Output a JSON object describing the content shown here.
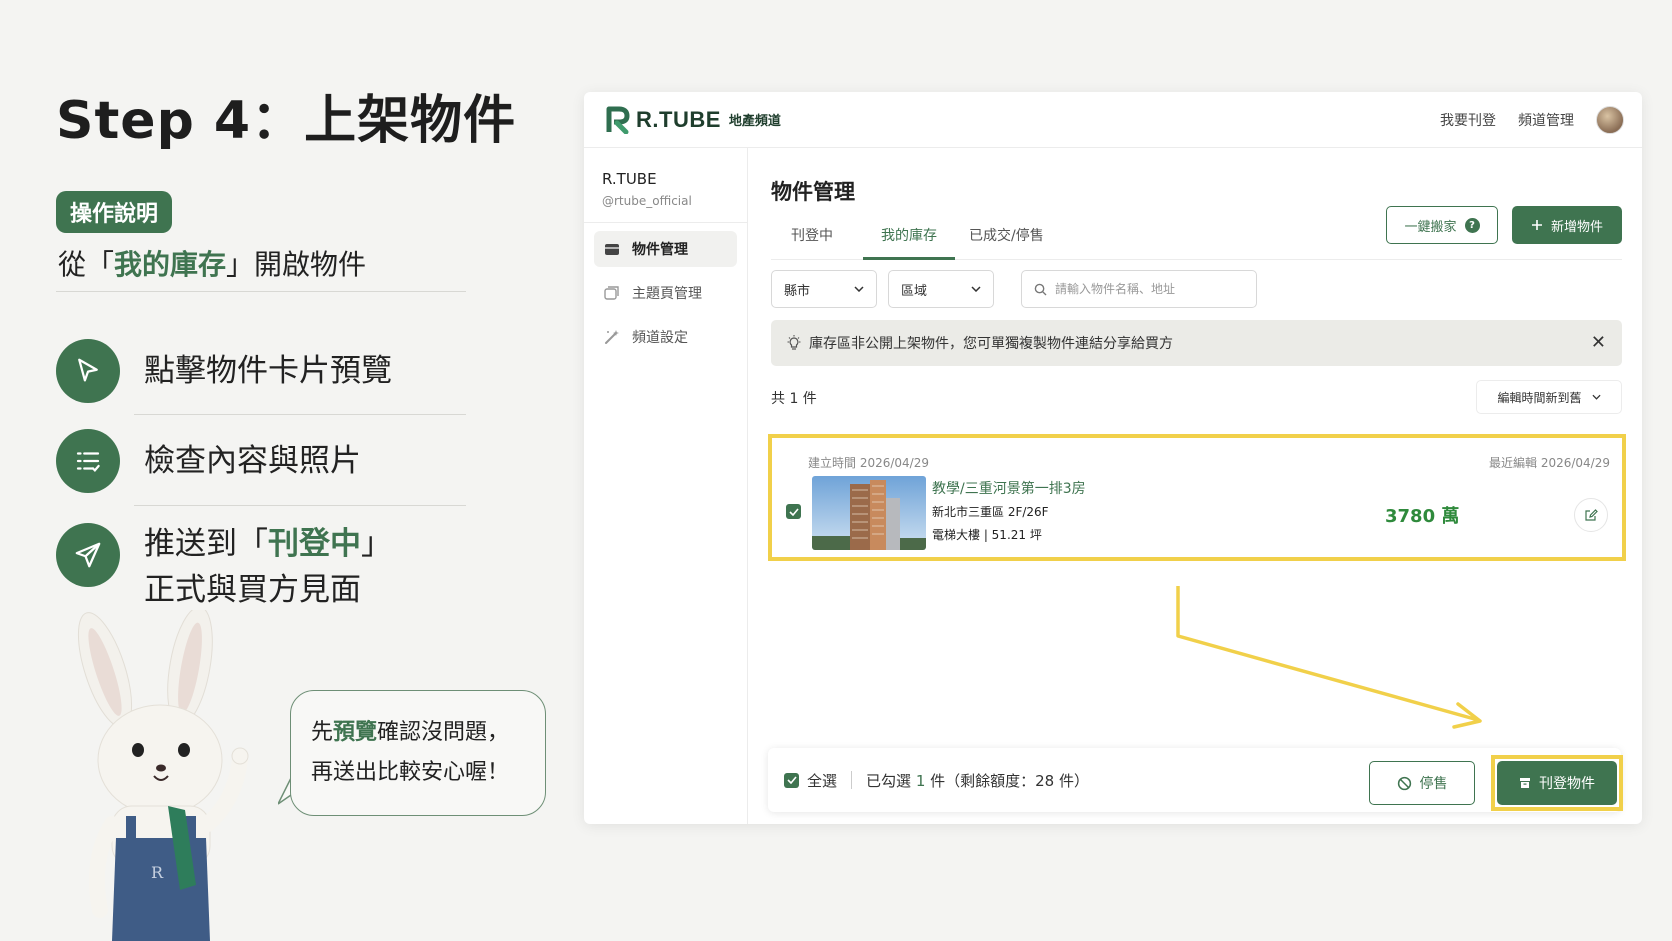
{
  "tutorial": {
    "title": "Step 4：上架物件",
    "badge": "操作說明",
    "line_pre": "從「",
    "line_hl": "我的庫存",
    "line_post": "」開啟物件",
    "steps": [
      {
        "icon": "cursor-icon",
        "text": "點擊物件卡片預覽"
      },
      {
        "icon": "checklist-icon",
        "text": "檢查內容與照片"
      },
      {
        "icon": "send-icon",
        "text_pre": "推送到「",
        "text_hl": "刊登中",
        "text_post": "」",
        "text_line2": "正式與買方見面"
      }
    ],
    "bubble": {
      "pre": "先",
      "hl": "預覽",
      "post": "確認沒問題，",
      "line2": "再送出比較安心喔！"
    }
  },
  "app": {
    "logo_name": "R.TUBE",
    "logo_sub": "地產頻道",
    "top_nav": [
      "我要刊登",
      "頻道管理"
    ],
    "sidebar": {
      "channel_name": "R.TUBE",
      "channel_handle": "@rtube_official",
      "items": [
        {
          "label": "物件管理",
          "icon": "house-icon",
          "active": true
        },
        {
          "label": "主題頁管理",
          "icon": "pages-icon",
          "active": false
        },
        {
          "label": "頻道設定",
          "icon": "magic-wand-icon",
          "active": false
        }
      ]
    },
    "page_title": "物件管理",
    "tabs": [
      "刊登中",
      "我的庫存",
      "已成交/停售"
    ],
    "active_tab": "我的庫存",
    "btn_move": "一鍵搬家",
    "btn_move_badge": "?",
    "btn_new": "新增物件",
    "filters": {
      "county": "縣市",
      "district": "區域",
      "search_placeholder": "請輸入物件名稱、地址"
    },
    "notice": "庫存區非公開上架物件，您可單獨複製物件連結分享給買方",
    "count_label": "共 1 件",
    "sort_label": "編輯時間新到舊",
    "listing": {
      "created": "建立時間 2026/04/29",
      "edited": "最近編輯 2026/04/29",
      "title": "教學/三重河景第一排3房",
      "address": "新北市三重區   2F/26F",
      "info": "電梯大樓 | 51.21 坪",
      "price": "3780 萬",
      "checked": true
    },
    "bottom_bar": {
      "select_all": "全選",
      "selected_pre": "已勾選",
      "selected_count": "1",
      "selected_post": "件（剩餘額度：28 件）",
      "btn_stop": "停售",
      "btn_publish": "刊登物件"
    }
  },
  "colors": {
    "brand_green": "#3f7450",
    "highlight_yellow": "#f1d04a",
    "price_green": "#2f8a3c"
  }
}
